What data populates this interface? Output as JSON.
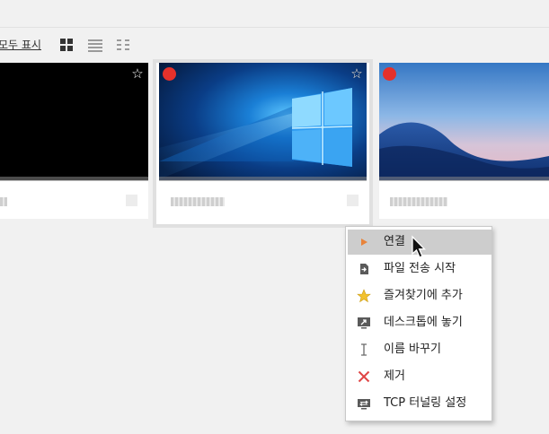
{
  "toolbar": {
    "show_all_label": "모두 표시"
  },
  "context_menu": {
    "items": [
      {
        "label": "연결",
        "icon": "play-icon"
      },
      {
        "label": "파일 전송 시작",
        "icon": "file-transfer-icon"
      },
      {
        "label": "즐겨찾기에 추가",
        "icon": "star-icon"
      },
      {
        "label": "데스크톱에 놓기",
        "icon": "desktop-shortcut-icon"
      },
      {
        "label": "이름 바꾸기",
        "icon": "text-cursor-icon"
      },
      {
        "label": "제거",
        "icon": "remove-x-icon"
      },
      {
        "label": "TCP 터널링 설정",
        "icon": "tcp-tunnel-icon"
      }
    ],
    "highlighted_item": "연결"
  },
  "colors": {
    "status_offline": "#e5312b",
    "remove_red": "#e04545",
    "play_orange": "#e8833a",
    "favorite_yellow": "#f2c12e"
  }
}
